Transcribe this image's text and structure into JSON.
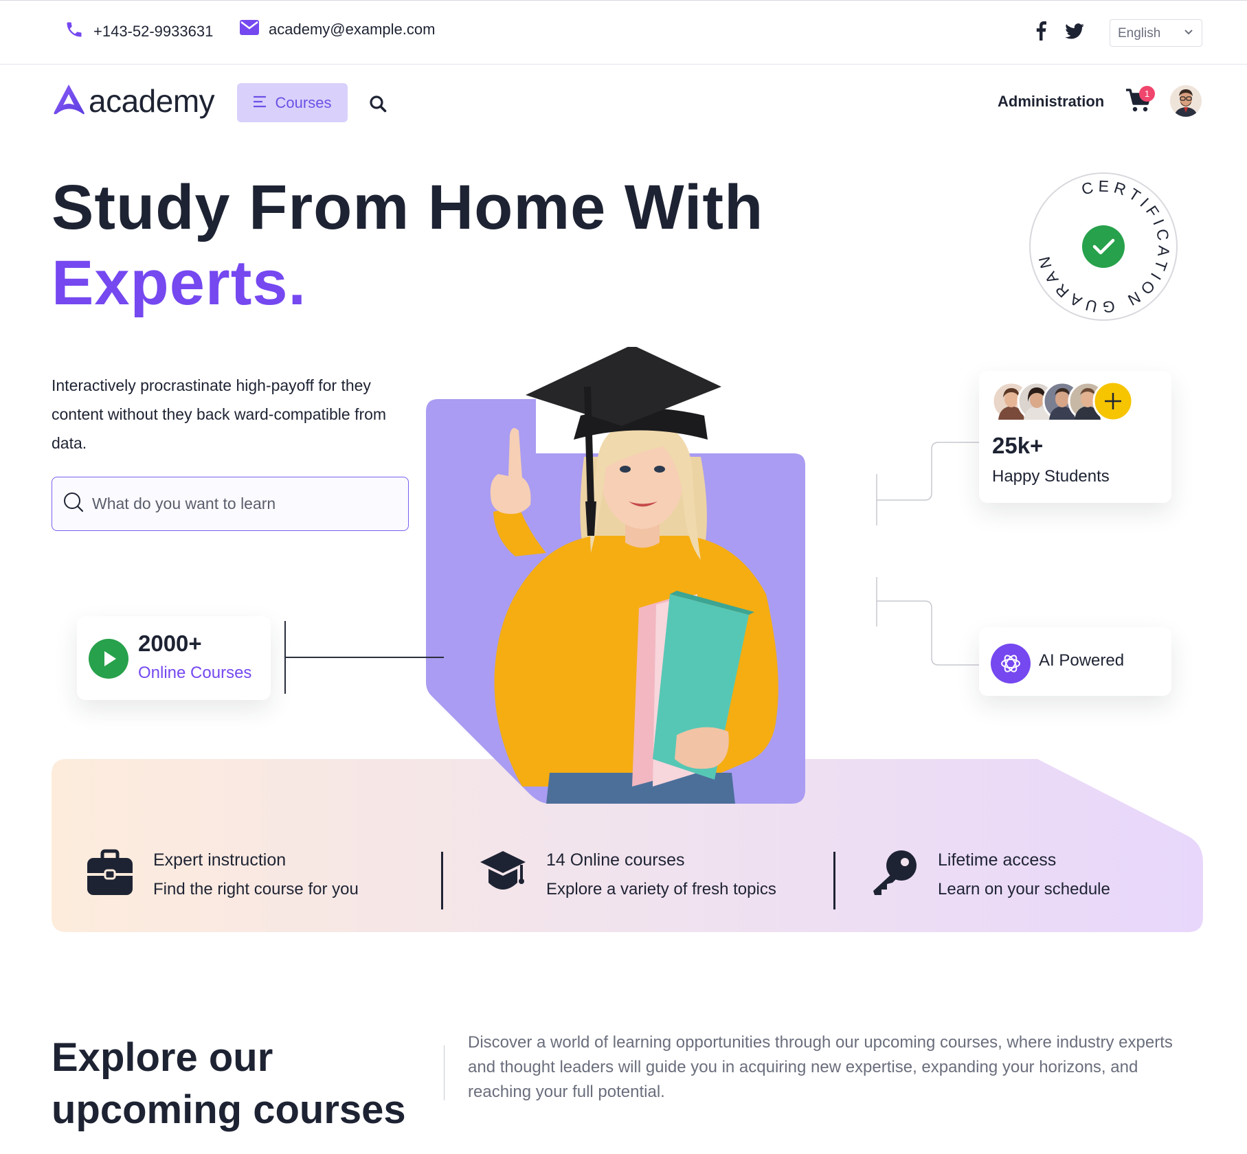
{
  "topbar": {
    "phone": "+143-52-9933631",
    "email": "academy@example.com",
    "language": "English"
  },
  "nav": {
    "logo_text": "academy",
    "courses_label": "Courses",
    "admin_label": "Administration",
    "cart_count": "1"
  },
  "hero": {
    "title_line1": "Study From Home With",
    "title_line2": "Experts.",
    "description": "Interactively procrastinate high-payoff for they content without they back ward-compatible from data.",
    "search_placeholder": "What do you want to learn",
    "badge_text": "CERTIFICATION GUARANTEE"
  },
  "stats": {
    "courses_count": "2000+",
    "courses_label": "Online Courses",
    "students_count": "25k+",
    "students_label": "Happy Students",
    "ai_label": "AI Powered"
  },
  "features": [
    {
      "title": "Expert instruction",
      "subtitle": "Find the right course for you",
      "icon": "briefcase-icon"
    },
    {
      "title": "14 Online courses",
      "subtitle": "Explore a variety of fresh topics",
      "icon": "graduation-cap-icon"
    },
    {
      "title": "Lifetime access",
      "subtitle": "Learn on your schedule",
      "icon": "key-icon"
    }
  ],
  "explore": {
    "title": "Explore our upcoming courses",
    "description": "Discover a world of learning opportunities through our upcoming courses, where industry experts and thought leaders will guide you in acquiring new expertise, expanding your horizons, and reaching your full potential."
  },
  "colors": {
    "brand": "#7548f0",
    "brand_light": "#d9d1fb",
    "dark": "#1e2333",
    "green": "#27a14b",
    "yellow": "#f7c400"
  }
}
